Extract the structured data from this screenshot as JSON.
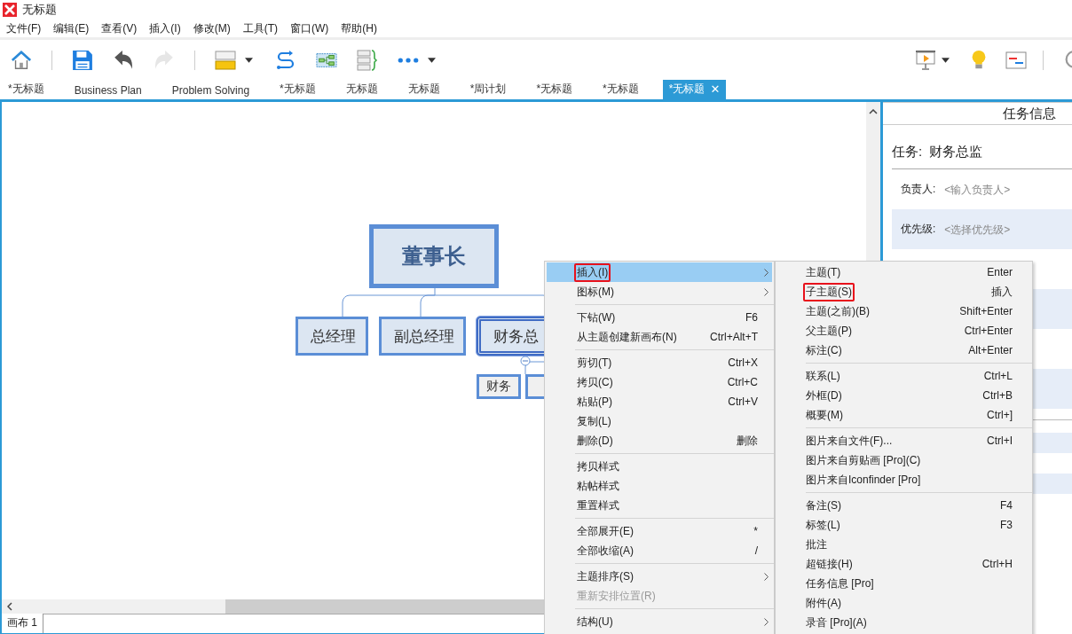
{
  "window": {
    "title": "无标题"
  },
  "menubar": [
    "文件(F)",
    "编辑(E)",
    "查看(V)",
    "插入(I)",
    "修改(M)",
    "工具(T)",
    "窗口(W)",
    "帮助(H)"
  ],
  "toolbar": {
    "left": [
      {
        "kind": "home",
        "disabled": false
      },
      {
        "kind": "separator"
      },
      {
        "kind": "save",
        "disabled": false
      },
      {
        "kind": "undo",
        "disabled": false
      },
      {
        "kind": "redo",
        "disabled": true
      },
      {
        "kind": "separator"
      },
      {
        "kind": "style",
        "disabled": false
      },
      {
        "kind": "caret",
        "disabled": false
      },
      {
        "kind": "relationship",
        "disabled": false
      },
      {
        "kind": "boundary",
        "disabled": false
      },
      {
        "kind": "summary",
        "disabled": false
      },
      {
        "kind": "more",
        "disabled": false
      },
      {
        "kind": "caret",
        "disabled": false
      }
    ],
    "right": [
      {
        "kind": "presentation",
        "disabled": false
      },
      {
        "kind": "caret",
        "disabled": false
      },
      {
        "kind": "idea",
        "disabled": false
      },
      {
        "kind": "gantt",
        "disabled": false
      },
      {
        "kind": "separator"
      },
      {
        "kind": "search",
        "disabled": false
      }
    ]
  },
  "tabs": [
    {
      "label": "*无标题",
      "selected": false
    },
    {
      "label": "Business Plan",
      "selected": false
    },
    {
      "label": "Problem Solving",
      "selected": false
    },
    {
      "label": "*无标题",
      "selected": false
    },
    {
      "label": "无标题",
      "selected": false
    },
    {
      "label": "无标题",
      "selected": false
    },
    {
      "label": "*周计划",
      "selected": false
    },
    {
      "label": "*无标题",
      "selected": false
    },
    {
      "label": "*无标题",
      "selected": false
    },
    {
      "label": "*无标题",
      "selected": true,
      "close": "✕"
    }
  ],
  "mind_map": {
    "nodes": [
      {
        "kind": "root",
        "label": "董事长",
        "selected": false
      },
      {
        "kind": "main",
        "label": "总经理",
        "selected": false
      },
      {
        "kind": "main",
        "label": "副总经理",
        "selected": false
      },
      {
        "kind": "main",
        "label": "财务总",
        "selected": true
      },
      {
        "kind": "sub",
        "label": "财务",
        "selected": false
      },
      {
        "kind": "sub",
        "selected": false
      }
    ]
  },
  "sheet_tabs": [
    {
      "label": "画布 1",
      "selected": true
    }
  ],
  "task_panel": {
    "title": "任务信息",
    "task_label": "任务:",
    "task_name": "财务总监",
    "fields": [
      {
        "label": "负责人:",
        "placeholder": "<输入负责人>"
      },
      {
        "label": "优先级:",
        "placeholder": "<选择优先级>"
      }
    ]
  },
  "context_menu": {
    "groups": [
      [
        {
          "label": "插入(I)",
          "selected": true,
          "outlined": true,
          "disabled": false,
          "submenu": true
        },
        {
          "label": "图标(M)",
          "selected": false,
          "outlined": false,
          "disabled": false,
          "submenu": true
        }
      ],
      [
        {
          "label": "下钻(W)",
          "shortcut": "F6",
          "selected": false,
          "outlined": false,
          "disabled": false,
          "submenu": false
        },
        {
          "label": "从主题创建新画布(N)",
          "shortcut": "Ctrl+Alt+T",
          "selected": false,
          "outlined": false,
          "disabled": false,
          "submenu": false
        }
      ],
      [
        {
          "label": "剪切(T)",
          "shortcut": "Ctrl+X",
          "selected": false,
          "outlined": false,
          "disabled": false,
          "submenu": false
        },
        {
          "label": "拷贝(C)",
          "shortcut": "Ctrl+C",
          "selected": false,
          "outlined": false,
          "disabled": false,
          "submenu": false
        },
        {
          "label": "粘贴(P)",
          "shortcut": "Ctrl+V",
          "selected": false,
          "outlined": false,
          "disabled": false,
          "submenu": false
        },
        {
          "label": "复制(L)",
          "selected": false,
          "outlined": false,
          "disabled": false,
          "submenu": false
        },
        {
          "label": "删除(D)",
          "shortcut": "删除",
          "selected": false,
          "outlined": false,
          "disabled": false,
          "submenu": false
        }
      ],
      [
        {
          "label": "拷贝样式",
          "selected": false,
          "outlined": false,
          "disabled": false,
          "submenu": false
        },
        {
          "label": "粘帖样式",
          "selected": false,
          "outlined": false,
          "disabled": false,
          "submenu": false
        },
        {
          "label": "重置样式",
          "selected": false,
          "outlined": false,
          "disabled": false,
          "submenu": false
        }
      ],
      [
        {
          "label": "全部展开(E)",
          "shortcut": "*",
          "selected": false,
          "outlined": false,
          "disabled": false,
          "submenu": false
        },
        {
          "label": "全部收缩(A)",
          "shortcut": "/",
          "selected": false,
          "outlined": false,
          "disabled": false,
          "submenu": false
        }
      ],
      [
        {
          "label": "主题排序(S)",
          "selected": false,
          "outlined": false,
          "disabled": false,
          "submenu": true
        },
        {
          "label": "重新安排位置(R)",
          "selected": false,
          "outlined": false,
          "disabled": true,
          "submenu": false
        }
      ],
      [
        {
          "label": "结构(U)",
          "selected": false,
          "outlined": false,
          "disabled": false,
          "submenu": true
        }
      ]
    ]
  },
  "submenu": {
    "groups": [
      [
        {
          "label": "主题(T)",
          "shortcut": "Enter",
          "selected": false,
          "outlined": false,
          "disabled": false,
          "submenu": false
        },
        {
          "label": "子主题(S)",
          "shortcut": "插入",
          "selected": false,
          "outlined": true,
          "disabled": false,
          "submenu": false
        },
        {
          "label": "主题(之前)(B)",
          "shortcut": "Shift+Enter",
          "selected": false,
          "outlined": false,
          "disabled": false,
          "submenu": false
        },
        {
          "label": "父主题(P)",
          "shortcut": "Ctrl+Enter",
          "selected": false,
          "outlined": false,
          "disabled": false,
          "submenu": false
        },
        {
          "label": "标注(C)",
          "shortcut": "Alt+Enter",
          "selected": false,
          "outlined": false,
          "disabled": false,
          "submenu": false
        }
      ],
      [
        {
          "label": "联系(L)",
          "shortcut": "Ctrl+L",
          "selected": false,
          "outlined": false,
          "disabled": false,
          "submenu": false
        },
        {
          "label": "外框(D)",
          "shortcut": "Ctrl+B",
          "selected": false,
          "outlined": false,
          "disabled": false,
          "submenu": false
        },
        {
          "label": "概要(M)",
          "shortcut": "Ctrl+]",
          "selected": false,
          "outlined": false,
          "disabled": false,
          "submenu": false
        }
      ],
      [
        {
          "label": "图片来自文件(F)...",
          "shortcut": "Ctrl+I",
          "selected": false,
          "outlined": false,
          "disabled": false,
          "submenu": false
        },
        {
          "label": "图片来自剪贴画 [Pro](C)",
          "selected": false,
          "outlined": false,
          "disabled": false,
          "submenu": false
        },
        {
          "label": "图片来自Iconfinder [Pro]",
          "selected": false,
          "outlined": false,
          "disabled": false,
          "submenu": false
        }
      ],
      [
        {
          "label": "备注(S)",
          "shortcut": "F4",
          "selected": false,
          "outlined": false,
          "disabled": false,
          "submenu": false
        },
        {
          "label": "标签(L)",
          "shortcut": "F3",
          "selected": false,
          "outlined": false,
          "disabled": false,
          "submenu": false
        },
        {
          "label": "批注",
          "selected": false,
          "outlined": false,
          "disabled": false,
          "submenu": false
        },
        {
          "label": "超链接(H)",
          "shortcut": "Ctrl+H",
          "selected": false,
          "outlined": false,
          "disabled": false,
          "submenu": false
        },
        {
          "label": "任务信息 [Pro]",
          "selected": false,
          "outlined": false,
          "disabled": false,
          "submenu": false
        },
        {
          "label": "附件(A)",
          "selected": false,
          "outlined": false,
          "disabled": false,
          "submenu": false
        },
        {
          "label": "录音 [Pro](A)",
          "selected": false,
          "outlined": false,
          "disabled": false,
          "submenu": false
        }
      ]
    ]
  }
}
